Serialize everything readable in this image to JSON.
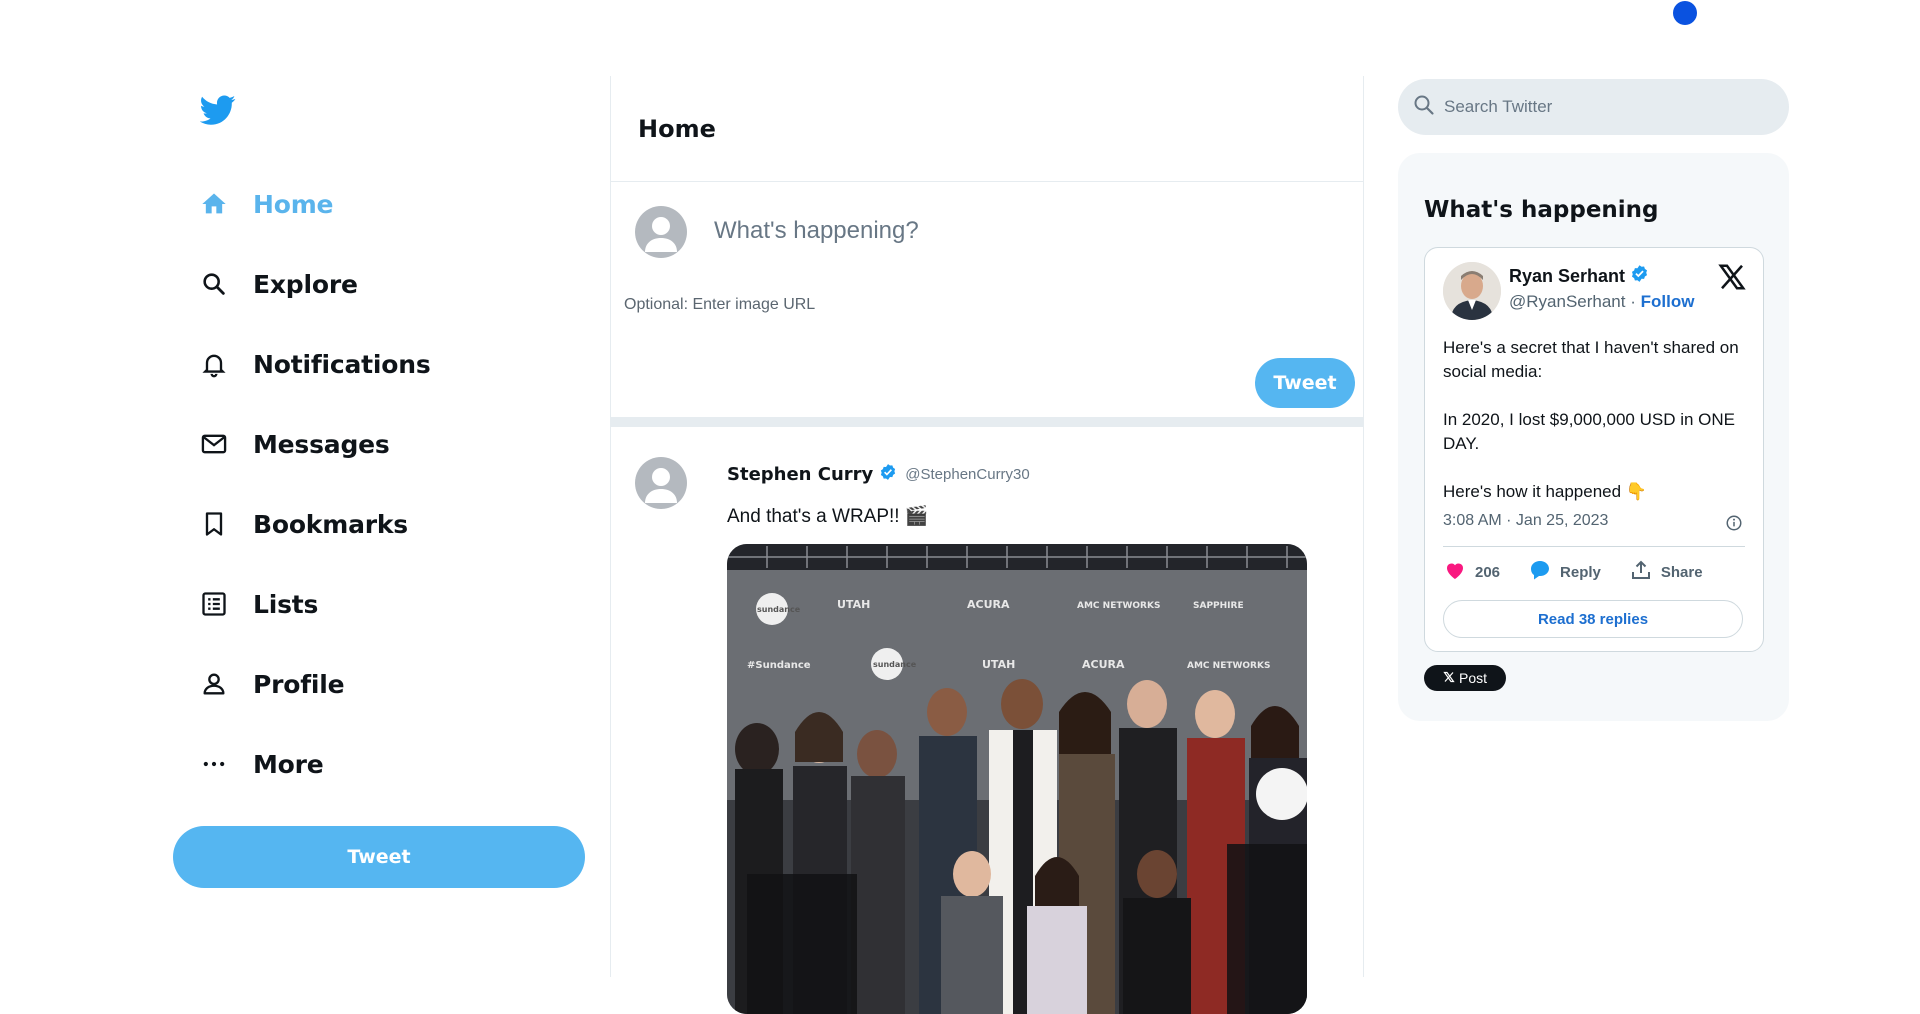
{
  "app": {
    "accent_color": "#1d9bf0",
    "button_color": "#55b6f1"
  },
  "sidebar": {
    "logo_icon": "twitter-bird-icon",
    "items": [
      {
        "label": "Home",
        "icon": "home-icon",
        "active": true
      },
      {
        "label": "Explore",
        "icon": "search-icon"
      },
      {
        "label": "Notifications",
        "icon": "bell-icon"
      },
      {
        "label": "Messages",
        "icon": "mail-icon"
      },
      {
        "label": "Bookmarks",
        "icon": "bookmark-icon"
      },
      {
        "label": "Lists",
        "icon": "list-icon"
      },
      {
        "label": "Profile",
        "icon": "person-icon"
      },
      {
        "label": "More",
        "icon": "more-icon"
      }
    ],
    "tweet_button": "Tweet"
  },
  "main": {
    "title": "Home",
    "composer": {
      "placeholder": "What's happening?",
      "image_placeholder": "Optional: Enter image URL",
      "tweet_button": "Tweet"
    },
    "tweets": [
      {
        "author": "Stephen Curry",
        "handle": "@StephenCurry30",
        "verified": true,
        "text": "And that's a WRAP!! 🎬",
        "media_logos": [
          "sundance",
          "UTAH",
          "ACURA",
          "AMC NETWORKS",
          "SAPPHIRE",
          "#Sundance",
          "sundance",
          "UTAH",
          "ACURA",
          "AMC NETWORKS"
        ]
      }
    ]
  },
  "right": {
    "search_placeholder": "Search Twitter",
    "trends_title": "What's happening",
    "embed": {
      "name": "Ryan Serhant",
      "handle": "@RyanSerhant",
      "separator": "·",
      "follow": "Follow",
      "paragraphs": [
        "Here's a secret that I haven't shared on social media:",
        "In 2020, I lost $9,000,000 USD in ONE DAY.",
        "Here's how it happened 👇"
      ],
      "time": "3:08 AM · Jan 25, 2023",
      "likes": "206",
      "reply": "Reply",
      "share": "Share",
      "read_replies": "Read 38 replies"
    },
    "x_post": "Post"
  }
}
